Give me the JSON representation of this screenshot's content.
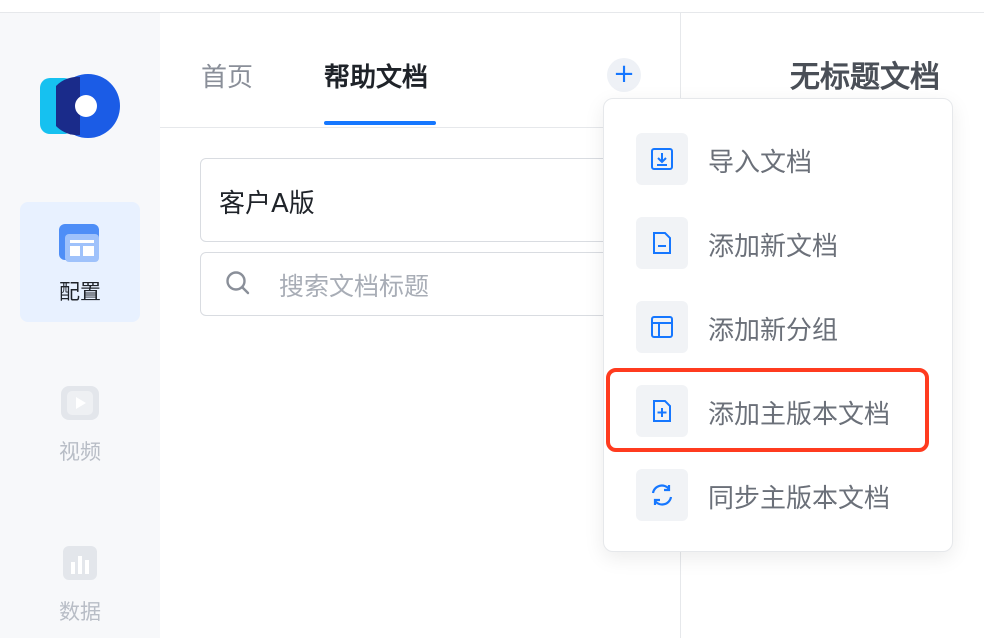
{
  "rail": {
    "items": [
      {
        "label": "配置",
        "icon": "layout-icon",
        "active": true
      },
      {
        "label": "视频",
        "icon": "video-icon",
        "active": false
      },
      {
        "label": "数据",
        "icon": "chart-icon",
        "active": false
      }
    ]
  },
  "tabs": [
    {
      "label": "首页"
    },
    {
      "label": "帮助文档"
    }
  ],
  "version_select": {
    "value": "客户A版"
  },
  "search": {
    "placeholder": "搜索文档标题"
  },
  "document": {
    "title": "无标题文档"
  },
  "menu": {
    "items": [
      {
        "label": "导入文档",
        "icon": "import-icon"
      },
      {
        "label": "添加新文档",
        "icon": "new-doc-icon"
      },
      {
        "label": "添加新分组",
        "icon": "new-group-icon"
      },
      {
        "label": "添加主版本文档",
        "icon": "add-master-doc-icon"
      },
      {
        "label": "同步主版本文档",
        "icon": "sync-icon"
      }
    ]
  },
  "colors": {
    "accent": "#1677ff",
    "highlight": "#ff3b1f",
    "active_bg": "#e8f1ff"
  }
}
